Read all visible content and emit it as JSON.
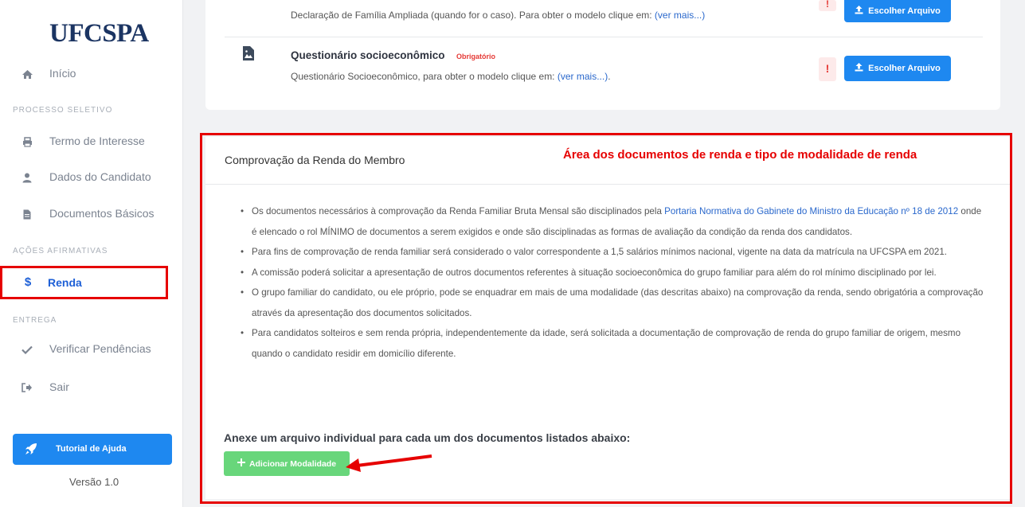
{
  "sidebar": {
    "logo": "UFCSPA",
    "home_label": "Início",
    "section_processo": "PROCESSO SELETIVO",
    "termo_label": "Termo de Interesse",
    "dados_label": "Dados do Candidato",
    "documentos_label": "Documentos Básicos",
    "section_acoes": "AÇÕES AFIRMATIVAS",
    "renda_icon": "$",
    "renda_label": "Renda",
    "section_entrega": "ENTREGA",
    "verificar_label": "Verificar Pendências",
    "sair_label": "Sair",
    "help_label": "Tutorial de Ajuda",
    "version": "Versão 1.0"
  },
  "top_card": {
    "row1_text": "Declaração de Família Ampliada (quando for o caso). Para obter o modelo clique em:",
    "row1_link": "(ver mais...)",
    "row2_title": "Questionário socioeconômico",
    "row2_badge": "Obrigatório",
    "row2_text": "Questionário Socioeconômico, para obter o modelo clique em:",
    "row2_link": "(ver mais...)",
    "row2_link_suffix": ".",
    "warn_mark": "!",
    "file_button": "Escolher Arquivo"
  },
  "main_card": {
    "header": "Comprovação da Renda do Membro",
    "annotation": "Área dos documentos de renda e tipo de modalidade de renda",
    "bullet1_pre": "Os documentos necessários à comprovação da Renda Familiar Bruta Mensal são disciplinados pela",
    "bullet1_link": "Portaria Normativa do Gabinete do Ministro da Educação nº 18 de 2012",
    "bullet1_post": "onde é elencado o rol MÍNIMO de documentos a serem exigidos e onde são disciplinadas as formas de avaliação da condição da renda dos candidatos.",
    "bullet2": "Para fins de comprovação de renda familiar será considerado o valor correspondente a 1,5 salários mínimos nacional, vigente na data da matrícula na UFCSPA em 2021.",
    "bullet3": "A comissão poderá solicitar a apresentação de outros documentos referentes à situação socioeconômica do grupo familiar para além do rol mínimo disciplinado por lei.",
    "bullet4": "O grupo familiar do candidato, ou ele próprio, pode se enquadrar em mais de uma modalidade (das descritas abaixo) na comprovação da renda, sendo obrigatória a comprovação através da apresentação dos documentos solicitados.",
    "bullet5": "Para candidatos solteiros e sem renda própria, independentemente da idade, será solicitada a documentação de comprovação de renda do grupo familiar de origem, mesmo quando o candidato residir em domicílio diferente.",
    "anexe": "Anexe um arquivo individual para cada um dos documentos listados abaixo:",
    "add_button": "Adicionar Modalidade"
  },
  "icons": {
    "home": "home-icon",
    "termo": "printer-icon",
    "dados": "user-icon",
    "documentos": "file-icon",
    "verificar": "check-icon",
    "sair": "sign-out-icon",
    "help": "rocket-icon",
    "upload": "upload-icon",
    "questionario": "file-image-icon",
    "add": "plus-icon"
  },
  "colors": {
    "accent_blue": "#1e88f0",
    "active_blue": "#1d5fd6",
    "highlight_red": "#e60000",
    "badge_red": "#e53935",
    "add_green": "#68d67b",
    "logo_navy": "#1b3462"
  }
}
